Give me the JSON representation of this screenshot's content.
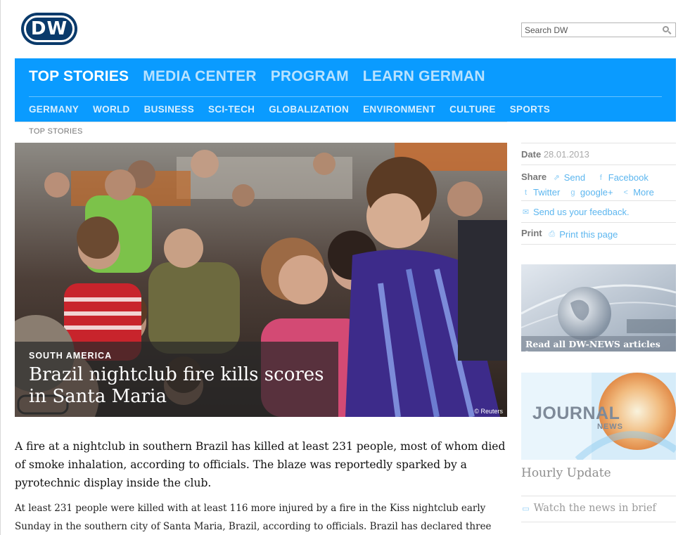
{
  "header": {
    "logo_text": "DW",
    "search": {
      "placeholder": "Search DW"
    }
  },
  "nav": {
    "primary": [
      {
        "label": "TOP STORIES",
        "active": true
      },
      {
        "label": "MEDIA CENTER",
        "active": false
      },
      {
        "label": "PROGRAM",
        "active": false
      },
      {
        "label": "LEARN GERMAN",
        "active": false
      }
    ],
    "secondary": [
      "GERMANY",
      "WORLD",
      "BUSINESS",
      "SCI-TECH",
      "GLOBALIZATION",
      "ENVIRONMENT",
      "CULTURE",
      "SPORTS"
    ],
    "bg_color": "#0a9bff"
  },
  "breadcrumb": "TOP STORIES",
  "hero": {
    "kicker": "SOUTH AMERICA",
    "title": "Brazil nightclub fire kills scores in Santa Maria",
    "credit": "© Reuters"
  },
  "article": {
    "lead": "A fire at a nightclub in southern Brazil has killed at least 231 people, most of whom died of smoke inhalation, according to officials. The blaze was reportedly sparked by a pyrotechnic display inside the club.",
    "body": "At least 231 people were killed with at least 116 more injured by a fire in the Kiss nightclub early Sunday in the southern city of Santa Maria, Brazil, according to officials. Brazil has declared three days"
  },
  "sidebar": {
    "date_label": "Date",
    "date_value": "28.01.2013",
    "share_label": "Share",
    "share_links": {
      "send": "Send",
      "facebook": "Facebook",
      "twitter": "Twitter",
      "googleplus": "google+",
      "more": "More"
    },
    "feedback": "Send us your feedback.",
    "print_label": "Print",
    "print_link": "Print this page",
    "promo_news": "Read all DW-NEWS articles here",
    "promo_journal": {
      "title": "JOURNAL",
      "subtitle": "NEWS"
    },
    "hourly": "Hourly Update",
    "watch": "Watch the news in brief"
  }
}
